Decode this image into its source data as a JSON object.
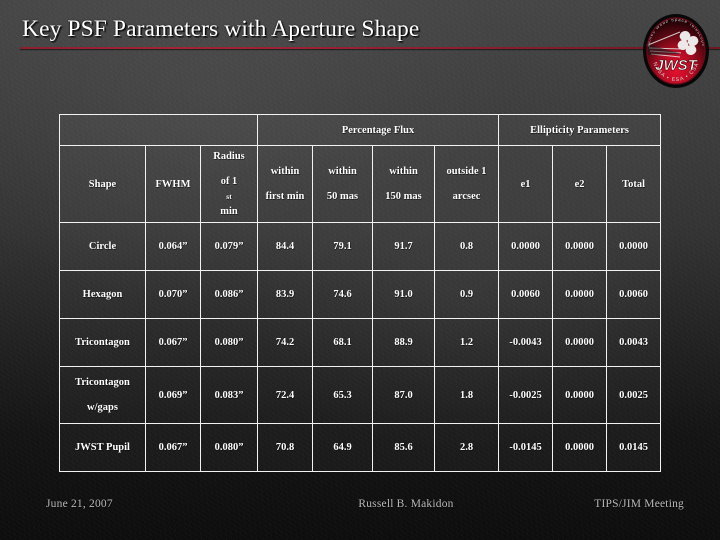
{
  "slide": {
    "title": "Key PSF Parameters with Aperture Shape",
    "accent_color": "#9d2235",
    "background_color": "#3a3a3a"
  },
  "logo": {
    "name": "jwst-logo",
    "wordmark": "JWST",
    "arc_top": "James Webb Space Telescope",
    "arc_bottom": "NASA • ESA • CSA",
    "color": "#c8102e"
  },
  "table": {
    "group_headers": [
      {
        "label": "",
        "span": 3
      },
      {
        "label": "Percentage Flux",
        "span": 4
      },
      {
        "label": "Ellipticity Parameters",
        "span": 3
      }
    ],
    "columns": [
      {
        "line1": "Shape",
        "line2": ""
      },
      {
        "line1": "FWHM",
        "line2": ""
      },
      {
        "line1": "Radius",
        "line2": "of 1st min",
        "sup": "st"
      },
      {
        "line1": "within",
        "line2": "first min"
      },
      {
        "line1": "within",
        "line2": "50 mas"
      },
      {
        "line1": "within",
        "line2": "150 mas"
      },
      {
        "line1": "outside 1",
        "line2": "arcsec"
      },
      {
        "line1": "e1",
        "line2": ""
      },
      {
        "line1": "e2",
        "line2": ""
      },
      {
        "line1": "Total",
        "line2": ""
      }
    ],
    "rows": [
      {
        "shape": "Circle",
        "shape_line2": "",
        "fwhm": "0.064”",
        "radius": "0.079”",
        "within_first_min": "84.4",
        "within_50mas": "79.1",
        "within_150mas": "91.7",
        "outside_1arcsec": "0.8",
        "e1": "0.0000",
        "e2": "0.0000",
        "total": "0.0000"
      },
      {
        "shape": "Hexagon",
        "shape_line2": "",
        "fwhm": "0.070”",
        "radius": "0.086”",
        "within_first_min": "83.9",
        "within_50mas": "74.6",
        "within_150mas": "91.0",
        "outside_1arcsec": "0.9",
        "e1": "0.0060",
        "e2": "0.0000",
        "total": "0.0060"
      },
      {
        "shape": "Tricontagon",
        "shape_line2": "",
        "fwhm": "0.067”",
        "radius": "0.080”",
        "within_first_min": "74.2",
        "within_50mas": "68.1",
        "within_150mas": "88.9",
        "outside_1arcsec": "1.2",
        "e1": "-0.0043",
        "e2": "0.0000",
        "total": "0.0043"
      },
      {
        "shape": "Tricontagon",
        "shape_line2": "w/gaps",
        "fwhm": "0.069”",
        "radius": "0.083”",
        "within_first_min": "72.4",
        "within_50mas": "65.3",
        "within_150mas": "87.0",
        "outside_1arcsec": "1.8",
        "e1": "-0.0025",
        "e2": "0.0000",
        "total": "0.0025"
      },
      {
        "shape": "JWST Pupil",
        "shape_line2": "",
        "fwhm": "0.067”",
        "radius": "0.080”",
        "within_first_min": "70.8",
        "within_50mas": "64.9",
        "within_150mas": "85.6",
        "outside_1arcsec": "2.8",
        "e1": "-0.0145",
        "e2": "0.0000",
        "total": "0.0145"
      }
    ]
  },
  "footer": {
    "date": "June 21, 2007",
    "author": "Russell B. Makidon",
    "meeting": "TIPS/JIM Meeting"
  }
}
